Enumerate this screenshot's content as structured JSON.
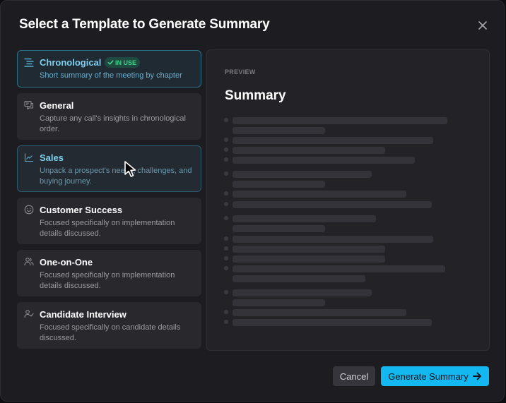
{
  "dialog": {
    "title": "Select a Template to Generate Summary",
    "close_icon": "close-icon"
  },
  "templates": [
    {
      "name": "Chronological",
      "description": "Short summary of the meeting by chapter",
      "icon": "list-lines-icon",
      "state": "selected",
      "badge": "IN USE"
    },
    {
      "name": "General",
      "description": "Capture any call's insights in chronological order.",
      "icon": "chat-bubbles-icon",
      "state": "default"
    },
    {
      "name": "Sales",
      "description": "Unpack a prospect's needs, challenges, and buying journey.",
      "icon": "line-chart-icon",
      "state": "hover"
    },
    {
      "name": "Customer Success",
      "description": "Focused specifically on implementation details discussed.",
      "icon": "smiley-icon",
      "state": "default"
    },
    {
      "name": "One-on-One",
      "description": "Focused specifically on implementation details discussed.",
      "icon": "users-icon",
      "state": "default"
    },
    {
      "name": "Candidate Interview",
      "description": "Focused specifically on candidate details discussed.",
      "icon": "user-check-icon",
      "state": "default"
    }
  ],
  "preview": {
    "label": "PREVIEW",
    "title": "Summary",
    "skeleton_lines": 20
  },
  "footer": {
    "cancel_label": "Cancel",
    "generate_label": "Generate Summary",
    "generate_icon": "arrow-right-icon"
  },
  "colors": {
    "accent": "#14b8f0",
    "badge_text": "#3fd18a",
    "badge_bg": "#1e4a3f",
    "background": "#1d1d21"
  }
}
